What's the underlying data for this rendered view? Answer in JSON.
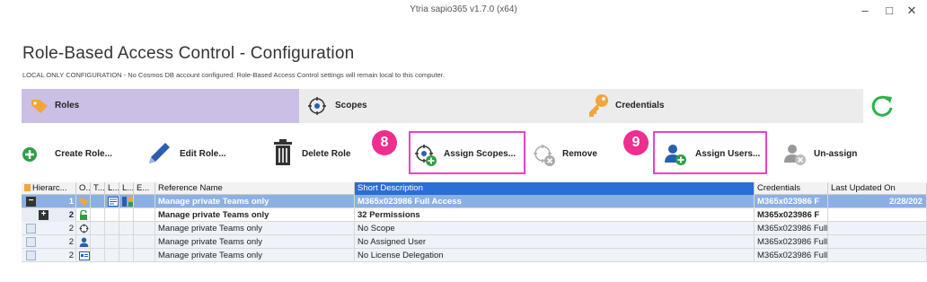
{
  "window": {
    "title": "Ytria sapio365 v1.7.0 (x64)",
    "minimize": "–",
    "maximize": "□",
    "close": "✕"
  },
  "page": {
    "title": "Role-Based Access Control - Configuration",
    "subtitle": "LOCAL ONLY CONFIGURATION - No Cosmos DB account configured: Role-Based Access Control settings will remain local to this computer."
  },
  "tabs": [
    {
      "label": "Roles",
      "icon": "tag-icon",
      "active": true
    },
    {
      "label": "Scopes",
      "icon": "scope-icon",
      "active": false
    },
    {
      "label": "Credentials",
      "icon": "key-icon",
      "active": false
    }
  ],
  "toolbar": {
    "create_role": "Create Role...",
    "edit_role": "Edit Role...",
    "delete_role": "Delete Role",
    "assign_scopes": "Assign Scopes...",
    "remove": "Remove",
    "assign_users": "Assign Users...",
    "unassign": "Un-assign"
  },
  "callouts": {
    "scopes_step": "8",
    "users_step": "9"
  },
  "colors": {
    "accent": "#cbbfe5",
    "highlight": "#e645c8",
    "badge": "#ee2f8f",
    "selected_row": "#8bb0e4",
    "header_selected": "#2a6ed6",
    "refresh": "#2bb24c",
    "add": "#2e9e46"
  },
  "grid": {
    "columns": [
      "Hierarc...",
      "O...",
      "T...",
      "L...",
      "L...",
      "E...",
      "Reference Name",
      "Short Description",
      "Credentials",
      "Last Updated On"
    ],
    "rows": [
      {
        "level": 1,
        "expander": "−",
        "hierarchy": "1",
        "reference_name": "Manage private Teams only",
        "short_description": "M365x023986 Full Access",
        "credentials": "M365x023986 F",
        "last_updated": "2/28/202"
      },
      {
        "level": 2,
        "expander": "+",
        "hierarchy": "2",
        "reference_name": "Manage private Teams only",
        "short_description": "32 Permissions",
        "credentials": "M365x023986 F",
        "last_updated": ""
      },
      {
        "level": 3,
        "expander": "",
        "hierarchy": "2",
        "reference_name": "Manage private Teams only",
        "short_description": "No Scope",
        "credentials": "M365x023986 Full",
        "last_updated": ""
      },
      {
        "level": 3,
        "expander": "",
        "hierarchy": "2",
        "reference_name": "Manage private Teams only",
        "short_description": "No Assigned User",
        "credentials": "M365x023986 Full",
        "last_updated": ""
      },
      {
        "level": 3,
        "expander": "",
        "hierarchy": "2",
        "reference_name": "Manage private Teams only",
        "short_description": "No License Delegation",
        "credentials": "M365x023986 Full",
        "last_updated": ""
      }
    ]
  }
}
